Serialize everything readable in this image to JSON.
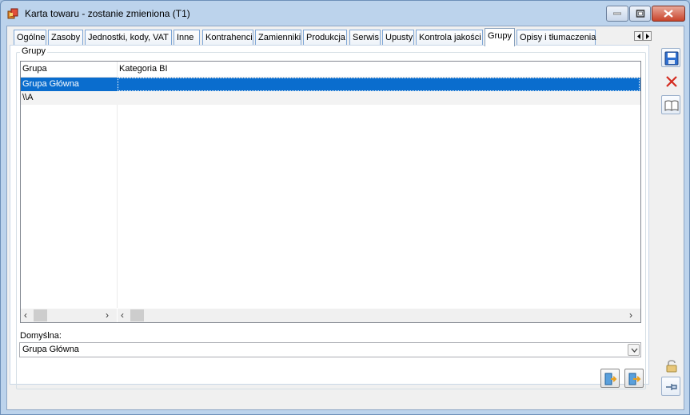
{
  "window": {
    "title": "Karta towaru - zostanie zmieniona (T1)"
  },
  "tabs": [
    {
      "label": "Ogólne"
    },
    {
      "label": "Zasoby"
    },
    {
      "label": "Jednostki, kody, VAT"
    },
    {
      "label": "Inne"
    },
    {
      "label": "Kontrahenci"
    },
    {
      "label": "Zamienniki"
    },
    {
      "label": "Produkcja"
    },
    {
      "label": "Serwis"
    },
    {
      "label": "Upusty"
    },
    {
      "label": "Kontrola jakości"
    },
    {
      "label": "Grupy"
    },
    {
      "label": "Opisy i tłumaczenia"
    }
  ],
  "active_tab": "Grupy",
  "group_box": {
    "legend": "Grupy"
  },
  "grid": {
    "columns": [
      "Grupa",
      "Kategoria BI"
    ],
    "rows": [
      {
        "grupa": "Grupa Główna",
        "kategoria_bi": "",
        "selected": true
      },
      {
        "grupa": "\\\\A",
        "kategoria_bi": "",
        "selected": false
      }
    ]
  },
  "default_field": {
    "label": "Domyślna:",
    "value": "Grupa Główna"
  },
  "colors": {
    "selection": "#0a6dce",
    "titlebar": "#bcd3ec",
    "close_button": "#c9442b"
  },
  "icons": {
    "save": "floppy-disk-icon",
    "cancel": "red-x-icon",
    "book": "open-book-icon",
    "lock": "padlock-icon",
    "pin": "pin-icon",
    "attach_left": "attach-group-icon",
    "attach_right": "detach-group-icon"
  }
}
